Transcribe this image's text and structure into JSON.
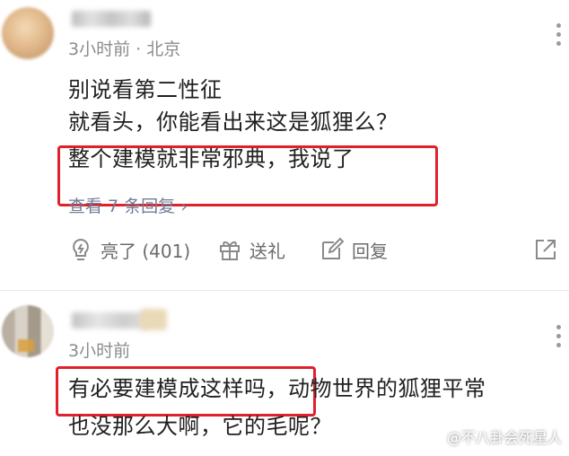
{
  "comment1": {
    "meta": "3小时前 · 北京",
    "lines": [
      "别说看第二性征",
      "就看头，你能看出来这是狐狸么？",
      "整个建模就非常邪典，我说了"
    ],
    "view_replies": "查看 7 条回复",
    "view_replies_chevron": "›",
    "actions": {
      "like_label": "亮了 (401)",
      "gift_label": "送礼",
      "reply_label": "回复"
    }
  },
  "comment2": {
    "meta": "3小时前",
    "line1_highlight": "有必要建模成这样吗，",
    "line1_rest": "动物世界的狐狸平常",
    "line2": "也没那么大啊，它的毛呢？"
  },
  "watermark": "@不八卦会死星人",
  "colors": {
    "highlight_border": "#e0212b",
    "meta_text": "#8c8c8c",
    "link_text": "#6f7d96",
    "action_text": "#6b6b6b"
  },
  "icons": [
    "more-icon",
    "bulb-icon",
    "gift-icon",
    "edit-icon",
    "share-icon"
  ]
}
